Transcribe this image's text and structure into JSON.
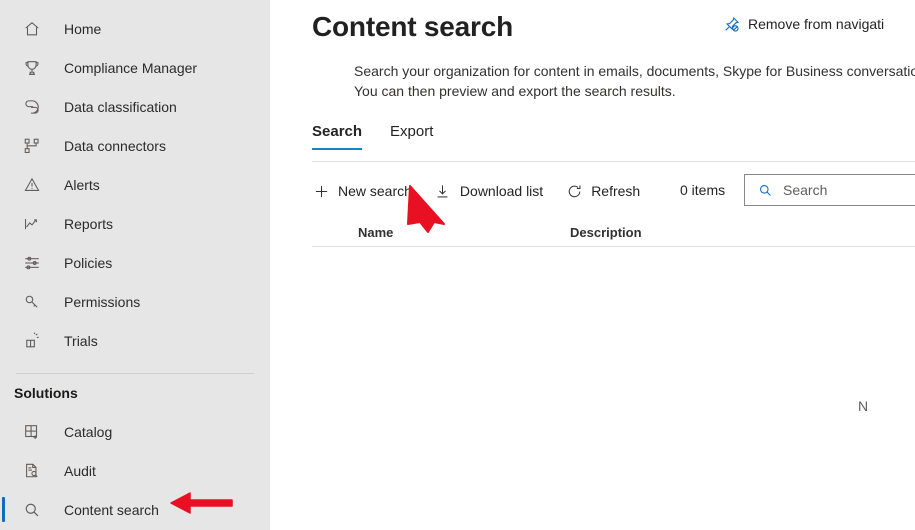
{
  "colors": {
    "sidebar_bg": "#e6e6e6",
    "accent_blue": "#0f6cbd",
    "tab_underline": "#1a85c4",
    "annotation_red": "#e81123",
    "text_primary": "#242424",
    "icon_gray": "#605e5c"
  },
  "sidebar": {
    "items": [
      {
        "id": "home",
        "label": "Home",
        "icon": "home-icon",
        "selected": false
      },
      {
        "id": "compliance-manager",
        "label": "Compliance Manager",
        "icon": "trophy-icon",
        "selected": false
      },
      {
        "id": "data-classification",
        "label": "Data classification",
        "icon": "tag-icon",
        "selected": false
      },
      {
        "id": "data-connectors",
        "label": "Data connectors",
        "icon": "hierarchy-icon",
        "selected": false
      },
      {
        "id": "alerts",
        "label": "Alerts",
        "icon": "warning-triangle-icon",
        "selected": false
      },
      {
        "id": "reports",
        "label": "Reports",
        "icon": "line-chart-icon",
        "selected": false
      },
      {
        "id": "policies",
        "label": "Policies",
        "icon": "sliders-icon",
        "selected": false
      },
      {
        "id": "permissions",
        "label": "Permissions",
        "icon": "key-icon",
        "selected": false
      },
      {
        "id": "trials",
        "label": "Trials",
        "icon": "gift-box-icon",
        "selected": false
      }
    ],
    "section_title": "Solutions",
    "solutions_items": [
      {
        "id": "catalog",
        "label": "Catalog",
        "icon": "grid-plus-icon",
        "selected": false
      },
      {
        "id": "audit",
        "label": "Audit",
        "icon": "document-search-icon",
        "selected": false
      },
      {
        "id": "content-search",
        "label": "Content search",
        "icon": "magnifier-icon",
        "selected": true
      }
    ]
  },
  "header": {
    "title": "Content search",
    "pin_action_label": "Remove from navigati",
    "pin_icon": "unpin-icon",
    "description": "Search your organization for content in emails, documents, Skype for Business conversations, and mo\nYou can then preview and export the search results."
  },
  "tabs": [
    {
      "id": "search",
      "label": "Search",
      "active": true
    },
    {
      "id": "export",
      "label": "Export",
      "active": false
    }
  ],
  "toolbar": {
    "commands": [
      {
        "id": "new-search",
        "label": "New search",
        "icon": "plus-icon"
      },
      {
        "id": "download-list",
        "label": "Download list",
        "icon": "download-icon"
      },
      {
        "id": "refresh",
        "label": "Refresh",
        "icon": "refresh-icon"
      }
    ],
    "items_count": "0 items",
    "search": {
      "placeholder": "Search",
      "value": "",
      "icon": "search-icon"
    }
  },
  "table": {
    "columns": [
      {
        "id": "name",
        "label": "Name"
      },
      {
        "id": "description",
        "label": "Description"
      }
    ],
    "rows": [],
    "empty_note": "N"
  },
  "annotations": [
    {
      "id": "arrow-new-search",
      "points_to": "new-search",
      "direction": "up-left",
      "color": "#e81123"
    },
    {
      "id": "arrow-content-search",
      "points_to": "content-search",
      "direction": "left",
      "color": "#e81123"
    }
  ]
}
